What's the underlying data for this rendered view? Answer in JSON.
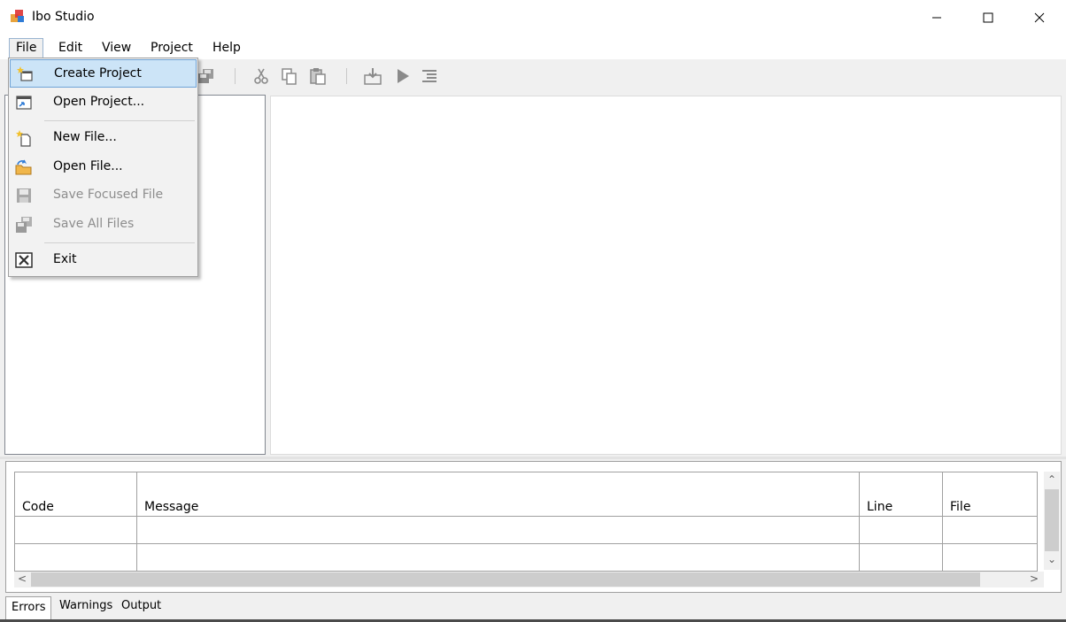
{
  "window": {
    "title": "Ibo Studio",
    "icon": "app-icon",
    "controls": [
      "minimize-icon",
      "maximize-icon",
      "close-icon"
    ]
  },
  "menubar": {
    "file": "File",
    "edit": "Edit",
    "view": "View",
    "project": "Project",
    "help": "Help"
  },
  "file_menu": {
    "create_project": "Create Project",
    "open_project": "Open Project...",
    "new_file": "New File...",
    "open_file": "Open File...",
    "save_focused_file": "Save Focused File",
    "save_all_files": "Save All Files",
    "exit": "Exit"
  },
  "toolbar": {
    "icons": [
      "save-all-icon",
      "cut-icon",
      "copy-icon",
      "paste-icon",
      "build-icon",
      "run-icon",
      "indent-icon"
    ]
  },
  "errors_grid": {
    "columns": [
      "Code",
      "Message",
      "Line",
      "File"
    ],
    "rows": [
      [
        "",
        "",
        "",
        ""
      ],
      [
        "",
        "",
        "",
        ""
      ]
    ]
  },
  "tabs": {
    "errors": "Errors",
    "warnings": "Warnings",
    "output": "Output"
  },
  "colors": {
    "menu_highlight": "#cce4f7",
    "menu_highlight_border": "#6fa3d6",
    "disabled_text": "#8d8d8d"
  }
}
